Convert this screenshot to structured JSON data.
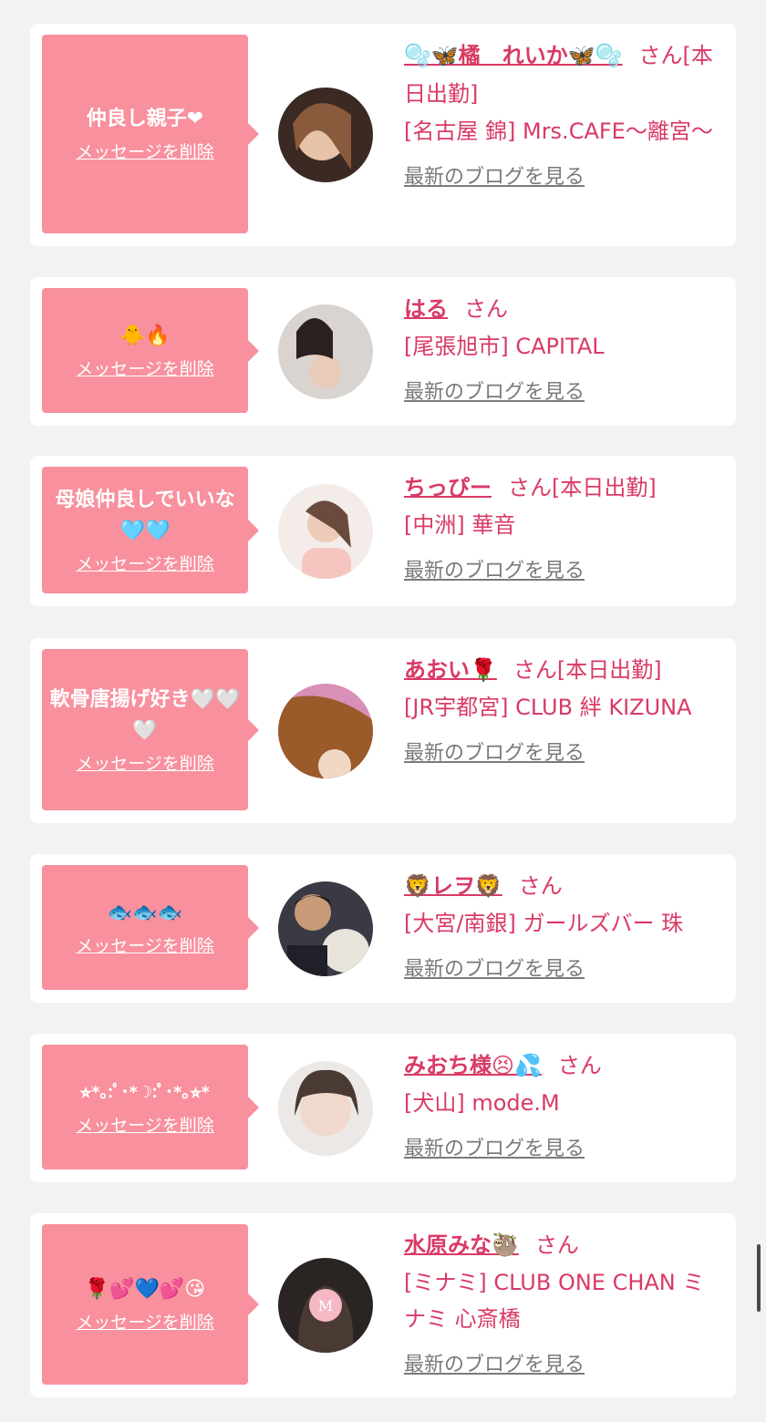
{
  "cards": [
    {
      "message": "仲良し親子❤",
      "delete_label": "メッセージを削除",
      "name": "🫧🦋橘　れいか🦋🫧",
      "san": "さん",
      "status": "[本日出勤]",
      "shop": "[名古屋 錦] Mrs.CAFE～離宮～",
      "blog_label": "最新のブログを見る"
    },
    {
      "message": "🐥🔥",
      "delete_label": "メッセージを削除",
      "name": "はる",
      "san": "さん",
      "status": "",
      "shop": "[尾張旭市] CAPITAL",
      "blog_label": "最新のブログを見る"
    },
    {
      "message": "母娘仲良しでいいな🩵🩵",
      "delete_label": "メッセージを削除",
      "name": "ちっぴー",
      "san": "さん",
      "status": "[本日出勤]",
      "shop": "[中洲] 華音",
      "blog_label": "最新のブログを見る"
    },
    {
      "message": "軟骨唐揚げ好き🤍🤍🤍",
      "delete_label": "メッセージを削除",
      "name": "あおい🌹",
      "san": "さん",
      "status": "[本日出勤]",
      "shop": "[JR宇都宮] CLUB 絆 KIZUNA",
      "blog_label": "最新のブログを見る"
    },
    {
      "message": "🐟🐟🐟",
      "delete_label": "メッセージを削除",
      "name": "🦁レヲ🦁",
      "san": "さん",
      "status": "",
      "shop": "[大宮/南銀] ガールズバー 珠",
      "blog_label": "最新のブログを見る"
    },
    {
      "message": "⭐︎*｡:ﾟ･*☽:ﾟ･*｡⭐︎*",
      "delete_label": "メッセージを削除",
      "name": "みおち様😣💦",
      "san": "さん",
      "status": "",
      "shop": "[犬山] mode.M",
      "blog_label": "最新のブログを見る"
    },
    {
      "message": "🌹💕💙💕😘",
      "delete_label": "メッセージを削除",
      "name": "水原みな🦥",
      "san": "さん",
      "status": "",
      "shop": "[ミナミ] CLUB ONE CHAN ミナミ 心斎橋",
      "blog_label": "最新のブログを見る"
    }
  ],
  "colors": {
    "accent": "#d93a65",
    "bubble": "#f8909d",
    "background": "#f2f2f2",
    "link_gray": "#7a7a7a"
  }
}
